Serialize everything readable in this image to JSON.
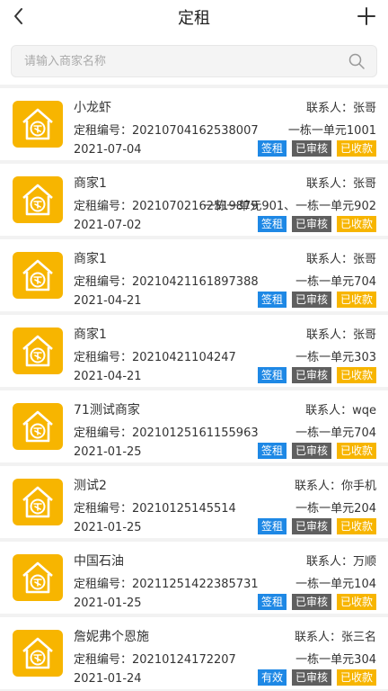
{
  "header": {
    "title": "定租"
  },
  "search": {
    "placeholder": "请输入商家名称"
  },
  "colors": {
    "accent": "#f7b500",
    "sign": "#1e88e5",
    "reviewed": "#5f5f5f",
    "paid": "#f7b500"
  },
  "icons": {
    "back": "chevron-left-icon",
    "add": "plus-icon",
    "search": "search-icon",
    "shop": "house-rent-icon"
  },
  "items": [
    {
      "name": "小龙虾",
      "contact": "联系人：张哥",
      "code": "定租编号：20210704162538007",
      "unit": "一栋一单元1001",
      "date": "2021-07-04",
      "status": "签租",
      "review": "已审核",
      "pay": "已收款"
    },
    {
      "name": "商家1",
      "contact": "联系人：张哥",
      "code": "定租编号：20210702162519879",
      "unit": "一栋一单元901、一栋一单元902",
      "date": "2021-07-02",
      "status": "签租",
      "review": "已审核",
      "pay": "已收款"
    },
    {
      "name": "商家1",
      "contact": "联系人：张哥",
      "code": "定租编号：20210421161897388",
      "unit": "一栋一单元704",
      "date": "2021-04-21",
      "status": "签租",
      "review": "已审核",
      "pay": "已收款"
    },
    {
      "name": "商家1",
      "contact": "联系人：张哥",
      "code": "定租编号：20210421104247",
      "unit": "一栋一单元303",
      "date": "2021-04-21",
      "status": "签租",
      "review": "已审核",
      "pay": "已收款"
    },
    {
      "name": "71测试商家",
      "contact": "联系人：wqe",
      "code": "定租编号：20210125161155963",
      "unit": "一栋一单元704",
      "date": "2021-01-25",
      "status": "签租",
      "review": "已审核",
      "pay": "已收款"
    },
    {
      "name": "测试2",
      "contact": "联系人：你手机",
      "code": "定租编号：20210125145514",
      "unit": "一栋一单元204",
      "date": "2021-01-25",
      "status": "签租",
      "review": "已审核",
      "pay": "已收款"
    },
    {
      "name": "中国石油",
      "contact": "联系人：万顺",
      "code": "定租编号：20211251422385731",
      "unit": "一栋一单元104",
      "date": "2021-01-25",
      "status": "签租",
      "review": "已审核",
      "pay": "已收款"
    },
    {
      "name": "詹妮弗个恩施",
      "contact": "联系人：张三名",
      "code": "定租编号：20210124172207",
      "unit": "一栋一单元304",
      "date": "2021-01-24",
      "status": "有效",
      "review": "已审核",
      "pay": "已收款"
    }
  ]
}
